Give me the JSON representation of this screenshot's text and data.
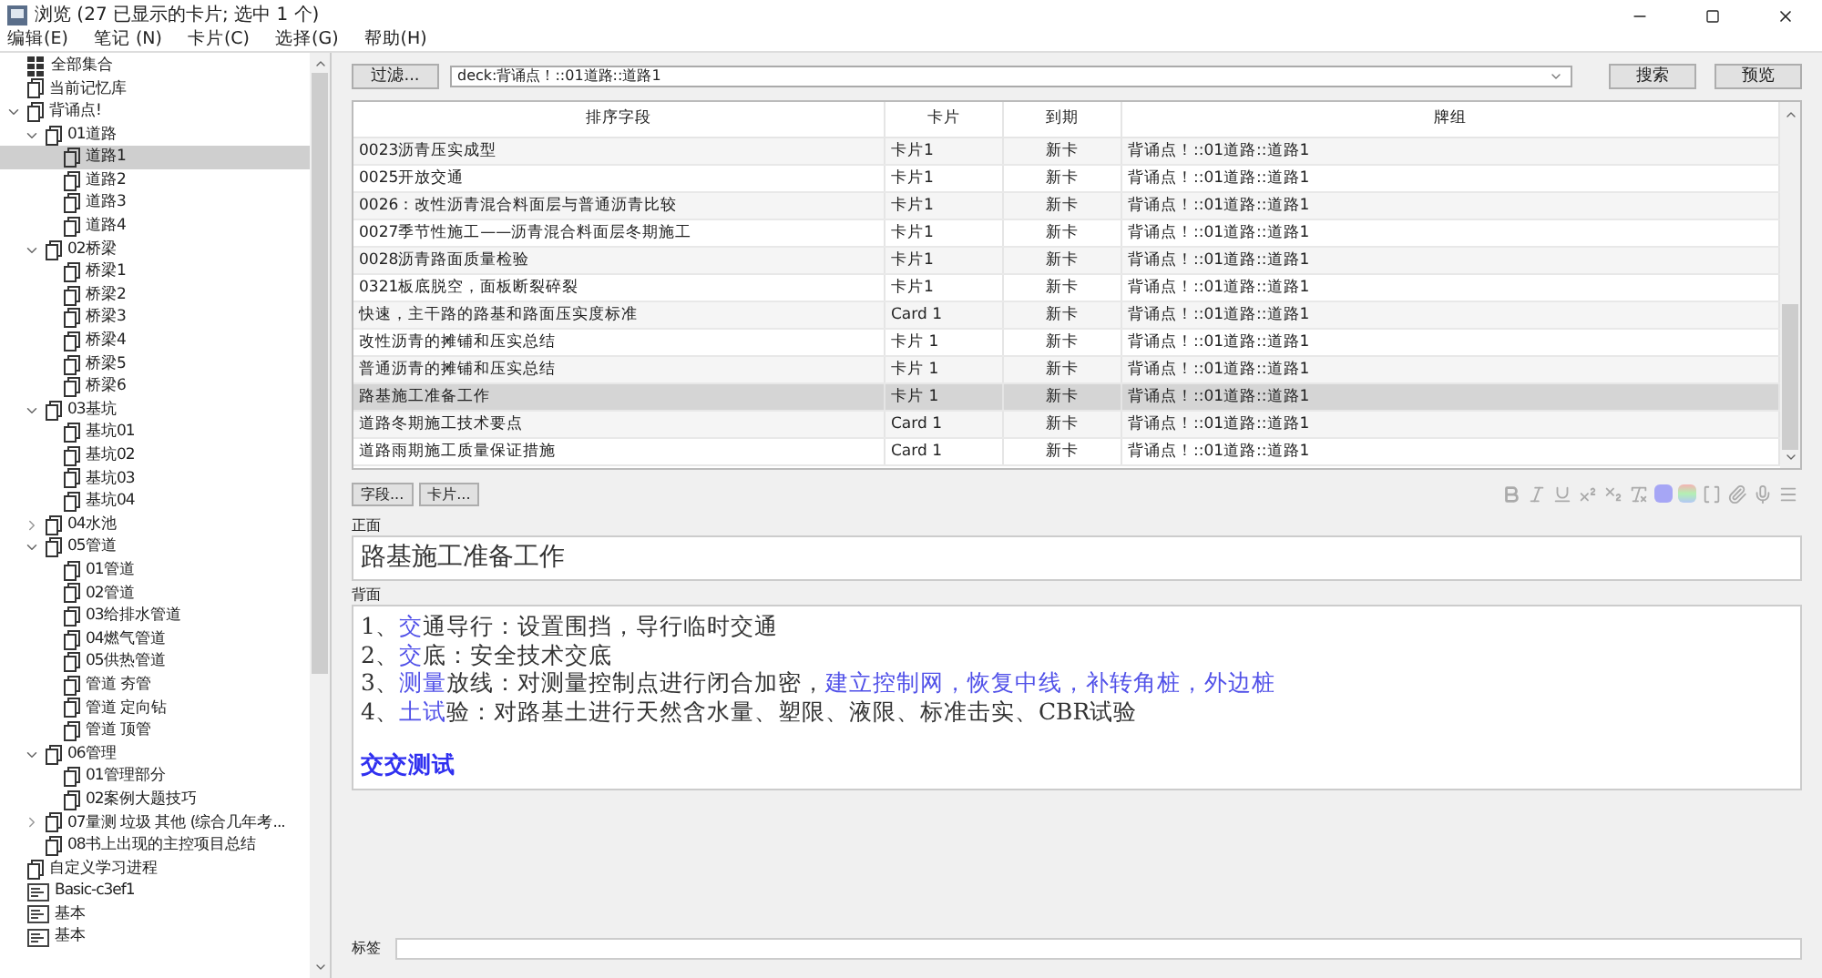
{
  "window": {
    "title": "浏览 (27 已显示的卡片; 选中 1 个)"
  },
  "menu": [
    "编辑(E)",
    "笔记 (N)",
    "卡片(C)",
    "选择(G)",
    "帮助(H)"
  ],
  "sidebar": {
    "items": [
      {
        "kind": "collection",
        "label": "全部集合",
        "selected": false
      },
      {
        "kind": "deck",
        "label": "当前记忆库",
        "selected": false
      },
      {
        "kind": "deck",
        "label": "背诵点!",
        "selected": false,
        "expanded": true,
        "children": [
          {
            "kind": "deck",
            "label": "01道路",
            "selected": false,
            "expanded": true,
            "children": [
              {
                "kind": "deck",
                "label": "道路1",
                "selected": true
              },
              {
                "kind": "deck",
                "label": "道路2",
                "selected": false
              },
              {
                "kind": "deck",
                "label": "道路3",
                "selected": false
              },
              {
                "kind": "deck",
                "label": "道路4",
                "selected": false
              }
            ]
          },
          {
            "kind": "deck",
            "label": "02桥梁",
            "selected": false,
            "expanded": true,
            "children": [
              {
                "kind": "deck",
                "label": "桥梁1",
                "selected": false
              },
              {
                "kind": "deck",
                "label": "桥梁2",
                "selected": false
              },
              {
                "kind": "deck",
                "label": "桥梁3",
                "selected": false
              },
              {
                "kind": "deck",
                "label": "桥梁4",
                "selected": false
              },
              {
                "kind": "deck",
                "label": "桥梁5",
                "selected": false
              },
              {
                "kind": "deck",
                "label": "桥梁6",
                "selected": false
              }
            ]
          },
          {
            "kind": "deck",
            "label": "03基坑",
            "selected": false,
            "expanded": true,
            "children": [
              {
                "kind": "deck",
                "label": "基坑01",
                "selected": false
              },
              {
                "kind": "deck",
                "label": "基坑02",
                "selected": false
              },
              {
                "kind": "deck",
                "label": "基坑03",
                "selected": false
              },
              {
                "kind": "deck",
                "label": "基坑04",
                "selected": false
              }
            ]
          },
          {
            "kind": "deck",
            "label": "04水池",
            "selected": false,
            "expanded": false,
            "collapsible": true
          },
          {
            "kind": "deck",
            "label": "05管道",
            "selected": false,
            "expanded": true,
            "children": [
              {
                "kind": "deck",
                "label": "01管道",
                "selected": false
              },
              {
                "kind": "deck",
                "label": "02管道",
                "selected": false
              },
              {
                "kind": "deck",
                "label": "03给排水管道",
                "selected": false
              },
              {
                "kind": "deck",
                "label": "04燃气管道",
                "selected": false
              },
              {
                "kind": "deck",
                "label": "05供热管道",
                "selected": false
              },
              {
                "kind": "deck",
                "label": "管道 夯管",
                "selected": false
              },
              {
                "kind": "deck",
                "label": "管道 定向钻",
                "selected": false
              },
              {
                "kind": "deck",
                "label": "管道 顶管",
                "selected": false
              }
            ]
          },
          {
            "kind": "deck",
            "label": "06管理",
            "selected": false,
            "expanded": true,
            "children": [
              {
                "kind": "deck",
                "label": "01管理部分",
                "selected": false
              },
              {
                "kind": "deck",
                "label": "02案例大题技巧",
                "selected": false
              }
            ]
          },
          {
            "kind": "deck",
            "label": "07量测 垃圾 其他 (综合几年考...",
            "selected": false,
            "expanded": false,
            "collapsible": true
          },
          {
            "kind": "deck",
            "label": "08书上出现的主控项目总结",
            "selected": false
          }
        ]
      },
      {
        "kind": "deck",
        "label": "自定义学习进程",
        "selected": false
      },
      {
        "kind": "notetype",
        "label": "Basic-c3ef1",
        "selected": false
      },
      {
        "kind": "notetype",
        "label": "基本",
        "selected": false
      },
      {
        "kind": "notetype",
        "label": "基本",
        "selected": false
      }
    ]
  },
  "filter_button": "过滤...",
  "search": {
    "value": "deck:背诵点！::01道路::道路1"
  },
  "search_button": "搜索",
  "preview_button": "预览",
  "table": {
    "columns": [
      "排序字段",
      "卡片",
      "到期",
      "牌组"
    ],
    "rows": [
      {
        "cells": [
          "0023沥青压实成型",
          "卡片1",
          "新卡",
          "背诵点！::01道路::道路1"
        ],
        "selected": false
      },
      {
        "cells": [
          "0025开放交通",
          "卡片1",
          "新卡",
          "背诵点！::01道路::道路1"
        ],
        "selected": false
      },
      {
        "cells": [
          "0026：改性沥青混合料面层与普通沥青比较",
          "卡片1",
          "新卡",
          "背诵点！::01道路::道路1"
        ],
        "selected": false
      },
      {
        "cells": [
          "0027季节性施工——沥青混合料面层冬期施工",
          "卡片1",
          "新卡",
          "背诵点！::01道路::道路1"
        ],
        "selected": false
      },
      {
        "cells": [
          "0028沥青路面质量检验",
          "卡片1",
          "新卡",
          "背诵点！::01道路::道路1"
        ],
        "selected": false
      },
      {
        "cells": [
          "0321板底脱空，面板断裂碎裂",
          "卡片1",
          "新卡",
          "背诵点！::01道路::道路1"
        ],
        "selected": false
      },
      {
        "cells": [
          "快速，主干路的路基和路面压实度标准",
          "Card 1",
          "新卡",
          "背诵点！::01道路::道路1"
        ],
        "selected": false
      },
      {
        "cells": [
          "改性沥青的摊铺和压实总结",
          "卡片 1",
          "新卡",
          "背诵点！::01道路::道路1"
        ],
        "selected": false
      },
      {
        "cells": [
          "普通沥青的摊铺和压实总结",
          "卡片 1",
          "新卡",
          "背诵点！::01道路::道路1"
        ],
        "selected": false
      },
      {
        "cells": [
          "路基施工准备工作",
          "卡片 1",
          "新卡",
          "背诵点！::01道路::道路1"
        ],
        "selected": true
      },
      {
        "cells": [
          "道路冬期施工技术要点",
          "Card 1",
          "新卡",
          "背诵点！::01道路::道路1"
        ],
        "selected": false
      },
      {
        "cells": [
          "道路雨期施工质量保证措施",
          "Card 1",
          "新卡",
          "背诵点！::01道路::道路1"
        ],
        "selected": false
      }
    ]
  },
  "editor": {
    "fields_button": "字段...",
    "cards_button": "卡片...",
    "front": {
      "label": "正面",
      "value": "路基施工准备工作"
    },
    "back": {
      "label": "背面",
      "lines": [
        {
          "segments": [
            {
              "text": "1、",
              "color": "#333333"
            },
            {
              "text": "交",
              "color": "#5050e8"
            },
            {
              "text": "通导行：设置围挡，导行临时交通",
              "color": "#333333"
            }
          ]
        },
        {
          "segments": [
            {
              "text": "2、",
              "color": "#333333"
            },
            {
              "text": "交",
              "color": "#5050e8"
            },
            {
              "text": "底：安全技术交底",
              "color": "#333333"
            }
          ]
        },
        {
          "segments": [
            {
              "text": "3、",
              "color": "#333333"
            },
            {
              "text": "测量",
              "color": "#5050e8"
            },
            {
              "text": "放线：对测量控制点进行闭合加密，",
              "color": "#333333"
            },
            {
              "text": "建立控制网，恢复中线，补转角桩，外边桩",
              "color": "#5050e8"
            }
          ]
        },
        {
          "segments": [
            {
              "text": "4、",
              "color": "#333333"
            },
            {
              "text": "土试",
              "color": "#5050e8"
            },
            {
              "text": "验：对路基土进行天然含水量、塑限、液限、标准击实、CBR试验",
              "color": "#333333"
            }
          ]
        },
        {
          "kind": "heading",
          "segments": [
            {
              "text": "交交测试",
              "color": "#3030f0"
            }
          ]
        }
      ]
    },
    "tags_label": "标签"
  }
}
